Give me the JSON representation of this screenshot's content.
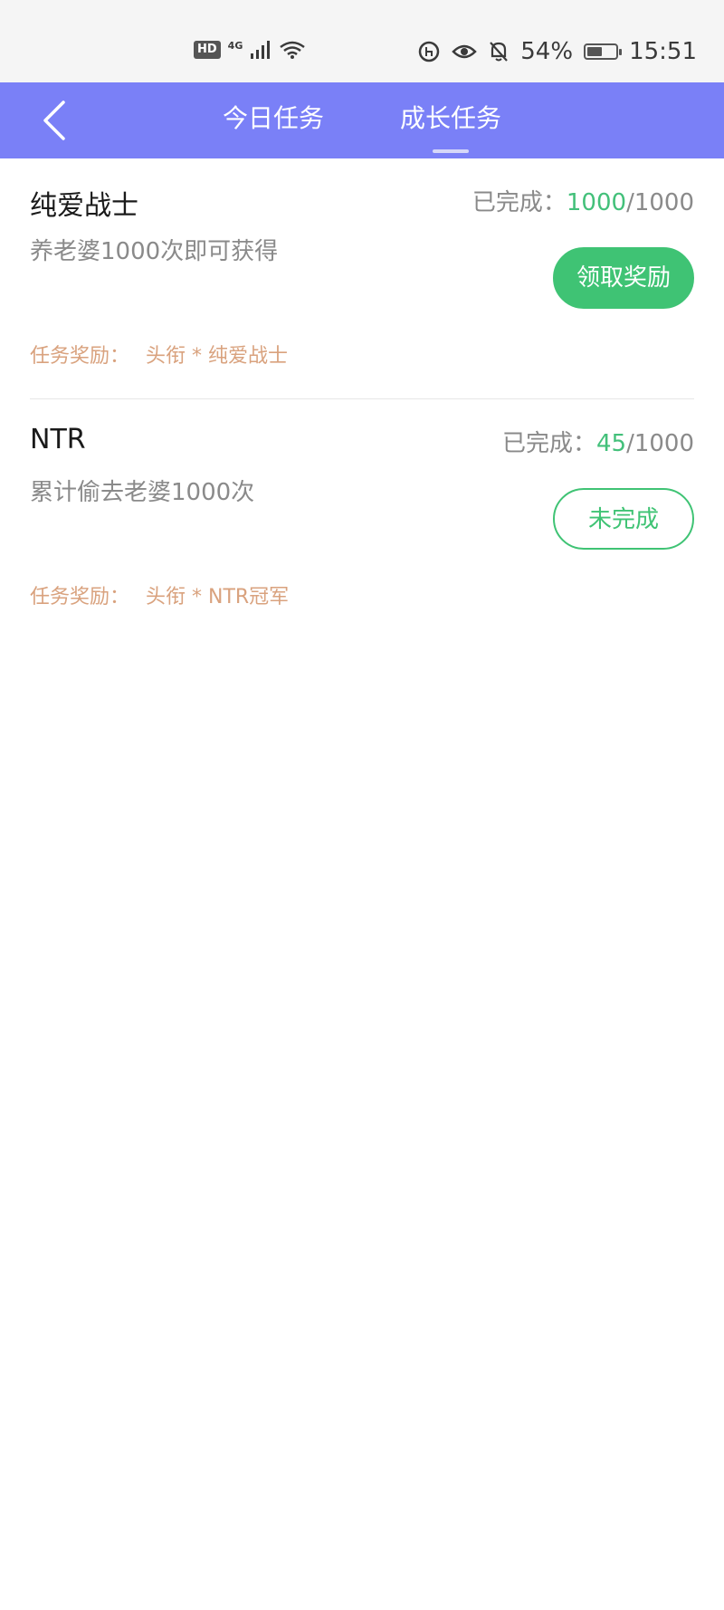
{
  "status_bar": {
    "hd_badge": "HD",
    "network_type": "4G",
    "battery_text": "54%",
    "battery_level": 0.54,
    "time": "15:51",
    "icons": [
      "signal-icon",
      "wifi-icon",
      "data-saver-icon",
      "eye-comfort-icon",
      "bell-off-icon",
      "battery-icon"
    ]
  },
  "header": {
    "background_color": "#7a80f7",
    "tabs": [
      {
        "label": "今日任务",
        "active": false
      },
      {
        "label": "成长任务",
        "active": true
      }
    ]
  },
  "tasks": [
    {
      "title": "纯爱战士",
      "description": "养老婆1000次即可获得",
      "progress_label": "已完成：",
      "progress_done": "1000",
      "progress_total": "/1000",
      "button_label": "领取奖励",
      "button_state": "claim",
      "reward_label": "任务奖励：",
      "reward_value": "头衔 * 纯爱战士"
    },
    {
      "title": "NTR",
      "description": "累计偷去老婆1000次",
      "progress_label": "已完成：",
      "progress_done": "45",
      "progress_total": "/1000",
      "button_label": "未完成",
      "button_state": "pending",
      "reward_label": "任务奖励：",
      "reward_value": "头衔 * NTR冠军"
    }
  ],
  "colors": {
    "accent_green": "#3fc374",
    "reward_text": "#d9a27e"
  }
}
